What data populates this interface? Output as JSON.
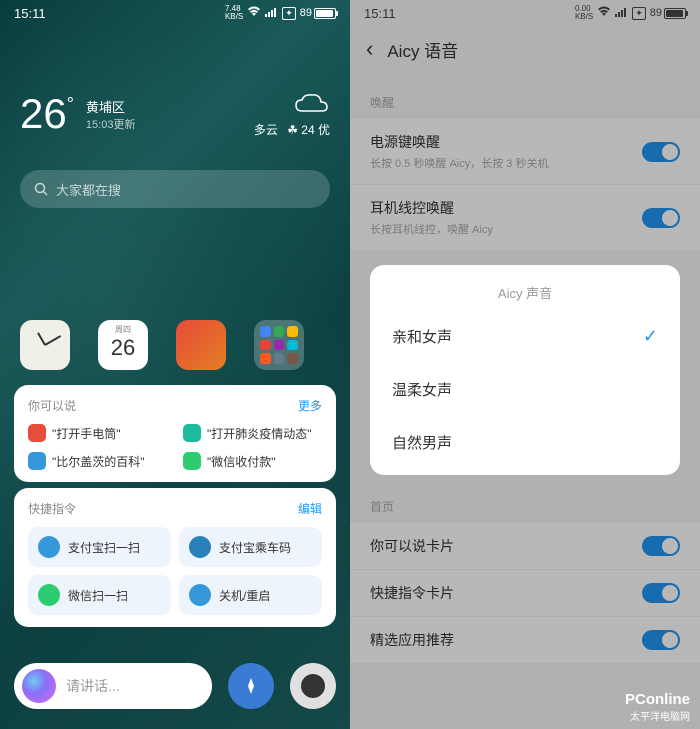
{
  "status": {
    "time": "15:11",
    "speed_left": "7.48\nKB/S",
    "speed_right": "0.00\nKB/S",
    "battery": "89"
  },
  "left": {
    "weather": {
      "temp": "26",
      "location": "黄埔区",
      "updated": "15:03更新",
      "condition": "多云",
      "aqi": "☘ 24 优"
    },
    "search_placeholder": "大家都在搜",
    "calendar": {
      "weekday": "周四",
      "date": "26"
    },
    "suggestions": {
      "title": "你可以说",
      "more": "更多",
      "items": [
        {
          "text": "\"打开手电筒\"",
          "color": "#e74c3c"
        },
        {
          "text": "\"打开肺炎疫情动态\"",
          "color": "#1abc9c"
        },
        {
          "text": "\"比尔盖茨的百科\"",
          "color": "#3498db"
        },
        {
          "text": "\"微信收付款\"",
          "color": "#2ecc71"
        }
      ]
    },
    "shortcuts": {
      "title": "快捷指令",
      "edit": "编辑",
      "items": [
        {
          "text": "支付宝扫一扫",
          "color": "#3498db"
        },
        {
          "text": "支付宝乘车码",
          "color": "#2980b9"
        },
        {
          "text": "微信扫一扫",
          "color": "#2ecc71"
        },
        {
          "text": "关机/重启",
          "color": "#3498db"
        }
      ]
    },
    "voice_placeholder": "请讲话..."
  },
  "right": {
    "page_title": "Aicy 语音",
    "section_wake": "唤醒",
    "settings_wake": [
      {
        "title": "电源键唤醒",
        "desc": "长按 0.5 秒唤醒 Aicy，长按 3 秒关机"
      },
      {
        "title": "耳机线控唤醒",
        "desc": "长按耳机线控，唤醒 Aicy"
      }
    ],
    "section_home": "首页",
    "settings_home": [
      {
        "title": "你可以说卡片"
      },
      {
        "title": "快捷指令卡片"
      },
      {
        "title": "精选应用推荐"
      }
    ],
    "modal": {
      "title": "Aicy 声音",
      "options": [
        "亲和女声",
        "温柔女声",
        "自然男声"
      ],
      "selected": 0
    }
  },
  "watermark": {
    "main": "PConline",
    "sub": "太平洋电脑网"
  }
}
